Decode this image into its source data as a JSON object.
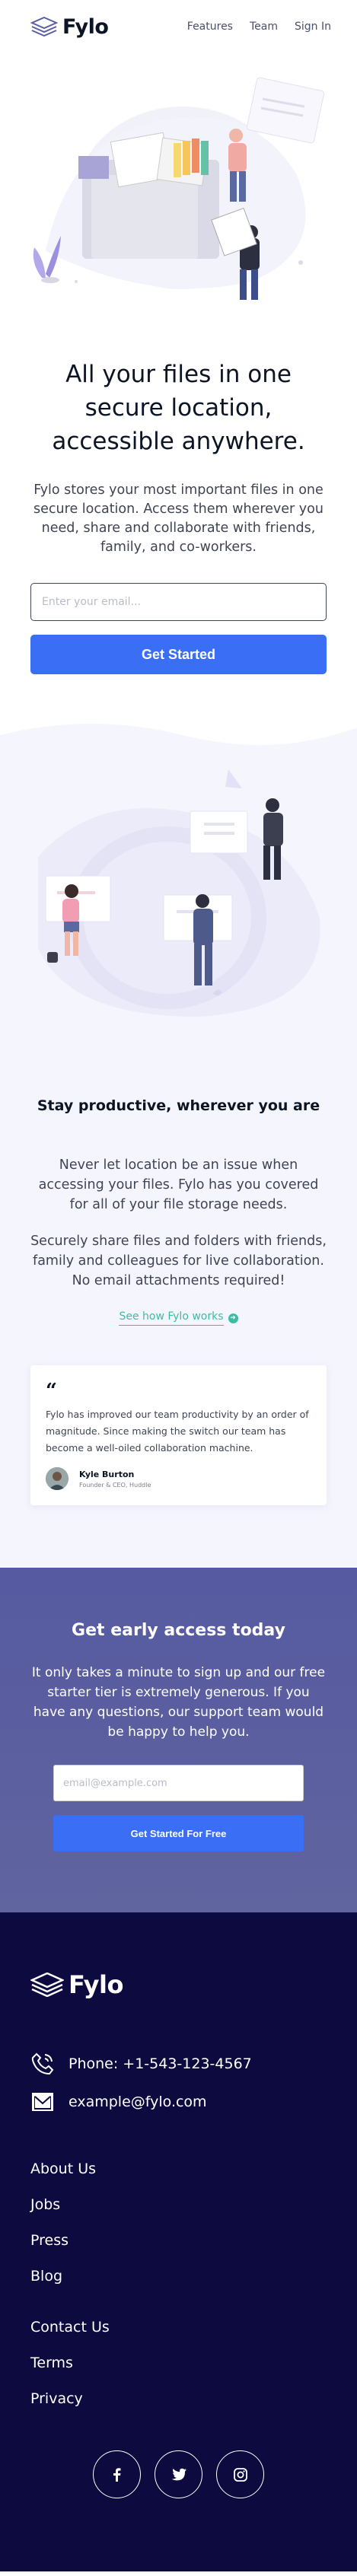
{
  "nav": {
    "logo": "Fylo",
    "links": [
      "Features",
      "Team",
      "Sign In"
    ]
  },
  "hero": {
    "title": "All your files in one secure location, accessible anywhere.",
    "description": "Fylo stores your most important files in one secure location. Access them wherever you need, share and collaborate with friends, family, and co-workers.",
    "email_placeholder": "Enter your email...",
    "button": "Get Started"
  },
  "features": {
    "title": "Stay productive, wherever you are",
    "paragraph_1": "Never let location be an issue when accessing your files. Fylo has you covered for all of your file storage needs.",
    "paragraph_2": "Securely share files and folders with friends, family and colleagues for live collaboration. No email attachments required!",
    "link": "See how Fylo works",
    "testimonial": {
      "quote_mark": "“",
      "text": "Fylo has improved our team productivity by an order of magnitude. Since making the switch our team has become a well-oiled collaboration machine.",
      "name": "Kyle Burton",
      "role": "Founder & CEO, Huddle"
    }
  },
  "cta": {
    "title": "Get early access today",
    "description": "It only takes a minute to sign up and our free starter tier is extremely generous. If you have any questions, our support team would be happy to help you.",
    "email_placeholder": "email@example.com",
    "button": "Get Started For Free"
  },
  "footer": {
    "logo": "Fylo",
    "phone": "Phone: +1-543-123-4567",
    "email": "example@fylo.com",
    "links_1": [
      "About Us",
      "Jobs",
      "Press",
      "Blog"
    ],
    "links_2": [
      "Contact Us",
      "Terms",
      "Privacy"
    ],
    "social_icons": [
      "facebook-icon",
      "twitter-icon",
      "instagram-icon"
    ]
  },
  "colors": {
    "accent": "#3a6ff5",
    "teal": "#3cbca3",
    "dark_navy": "#0c0a3e",
    "cta_purple": "#5a5fa3",
    "features_bg": "#f5f5fe"
  }
}
